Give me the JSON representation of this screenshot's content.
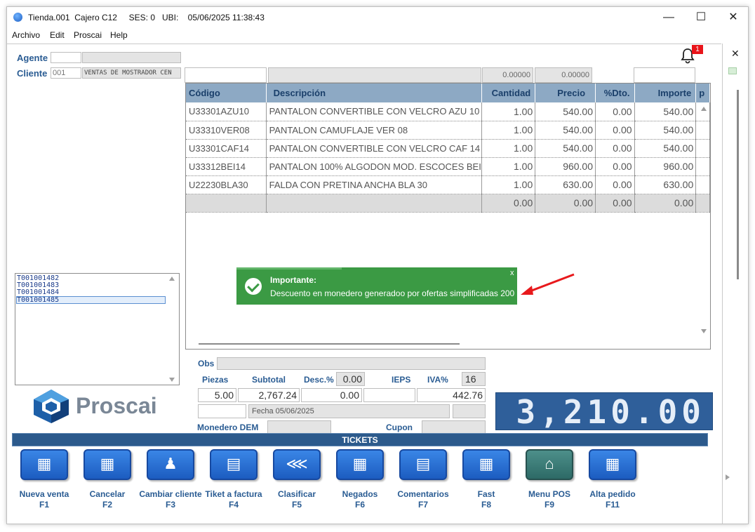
{
  "window": {
    "title": "Tienda.001  Cajero C12     SES: 0   UBI:    05/06/2025 11:38:43",
    "minimize": "—",
    "maximize": "☐",
    "close": "✕"
  },
  "menu": [
    "Archivo",
    "Edit",
    "Proscai",
    "Help"
  ],
  "header": {
    "agente_label": "Agente",
    "cliente_label": "Cliente",
    "cliente_code": "001",
    "cliente_name": "VENTAS DE MOSTRADOR CEN",
    "notification_count": "1",
    "top_value_1": "0.00000",
    "top_value_2": "0.00000"
  },
  "grid": {
    "columns": [
      "Código",
      "Descripción",
      "Cantidad",
      "Precio",
      "%Dto.",
      "Importe",
      "p"
    ],
    "rows": [
      {
        "codigo": "U33301AZU10",
        "descripcion": "PANTALON CONVERTIBLE CON VELCRO AZU 10",
        "cantidad": "1.00",
        "precio": "540.00",
        "dto": "0.00",
        "importe": "540.00"
      },
      {
        "codigo": "U33310VER08",
        "descripcion": "PANTALON  CAMUFLAJE VER 08",
        "cantidad": "1.00",
        "precio": "540.00",
        "dto": "0.00",
        "importe": "540.00"
      },
      {
        "codigo": "U33301CAF14",
        "descripcion": "PANTALON CONVERTIBLE CON VELCRO CAF 14",
        "cantidad": "1.00",
        "precio": "540.00",
        "dto": "0.00",
        "importe": "540.00"
      },
      {
        "codigo": "U33312BEI14",
        "descripcion": "PANTALON 100%  ALGODON MOD. ESCOCES BEI",
        "cantidad": "1.00",
        "precio": "960.00",
        "dto": "0.00",
        "importe": "960.00"
      },
      {
        "codigo": "U22230BLA30",
        "descripcion": "FALDA CON PRETINA ANCHA BLA 30",
        "cantidad": "1.00",
        "precio": "630.00",
        "dto": "0.00",
        "importe": "630.00"
      }
    ],
    "total_row": {
      "cantidad": "0.00",
      "precio": "0.00",
      "dto": "0.00",
      "importe": "0.00"
    }
  },
  "tickets_list": [
    "T001001482",
    "T001001483",
    "T001001484",
    "T001001485"
  ],
  "toast": {
    "title": "Importante:",
    "message": "Descuento en monedero generadoo por ofertas simplificadas 200",
    "close": "x"
  },
  "summary": {
    "obs_label": "Obs",
    "piezas_label": "Piezas",
    "subtotal_label": "Subtotal",
    "desc_label": "Desc.%",
    "desc_pct": "0.00",
    "ieps_label": "IEPS",
    "iva_label": "IVA%",
    "iva_pct": "16",
    "piezas": "5.00",
    "subtotal": "2,767.24",
    "descuento": "0.00",
    "iva": "442.76",
    "fecha": "Fecha 05/06/2025",
    "monedero_label": "Monedero DEM",
    "cupon_label": "Cupon",
    "total": "3,210.00"
  },
  "logo_text": "Proscai",
  "tickets_bar": "TICKETS",
  "buttons": [
    {
      "label": "Nueva venta",
      "key": "F1",
      "icon": "new-sale-icon"
    },
    {
      "label": "Cancelar",
      "key": "F2",
      "icon": "cancel-icon"
    },
    {
      "label": "Cambiar cliente",
      "key": "F3",
      "icon": "users-icon"
    },
    {
      "label": "Tiket a factura",
      "key": "F4",
      "icon": "invoice-icon"
    },
    {
      "label": "Clasificar",
      "key": "F5",
      "icon": "tree-icon"
    },
    {
      "label": "Negados",
      "key": "F6",
      "icon": "grid-icon"
    },
    {
      "label": "Comentarios",
      "key": "F7",
      "icon": "comment-icon"
    },
    {
      "label": "Fast",
      "key": "F8",
      "icon": "fast-icon"
    },
    {
      "label": "Menu POS",
      "key": "F9",
      "icon": "home-icon"
    },
    {
      "label": "Alta pedido",
      "key": "F11",
      "icon": "new-order-icon"
    }
  ]
}
